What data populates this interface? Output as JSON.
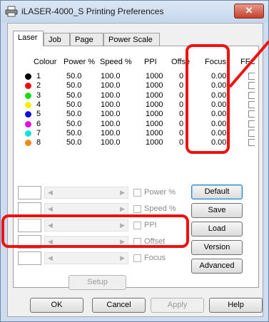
{
  "window": {
    "title": "iLASER-4000_S Printing Preferences",
    "close_label": "✕"
  },
  "tabs": [
    {
      "label": "Laser",
      "active": true
    },
    {
      "label": "Job",
      "active": false
    },
    {
      "label": "Page",
      "active": false
    },
    {
      "label": "Power Scale",
      "active": false
    }
  ],
  "table": {
    "headers": [
      "Colour",
      "Power %",
      "Speed %",
      "PPI",
      "Offse",
      "Focus",
      "FFO"
    ],
    "rows": [
      {
        "num": "1",
        "color": "#000000",
        "power": "50.0",
        "speed": "100.0",
        "ppi": "1000",
        "offset": "0",
        "focus": "0.00"
      },
      {
        "num": "2",
        "color": "#e81010",
        "power": "50.0",
        "speed": "100.0",
        "ppi": "1000",
        "offset": "0",
        "focus": "0.00"
      },
      {
        "num": "3",
        "color": "#18d818",
        "power": "50.0",
        "speed": "100.0",
        "ppi": "1000",
        "offset": "0",
        "focus": "0.00"
      },
      {
        "num": "4",
        "color": "#f5f000",
        "power": "50.0",
        "speed": "100.0",
        "ppi": "1000",
        "offset": "0",
        "focus": "0.00"
      },
      {
        "num": "5",
        "color": "#1010d8",
        "power": "50.0",
        "speed": "100.0",
        "ppi": "1000",
        "offset": "0",
        "focus": "0.00"
      },
      {
        "num": "6",
        "color": "#e010e0",
        "power": "50.0",
        "speed": "100.0",
        "ppi": "1000",
        "offset": "0",
        "focus": "0.00"
      },
      {
        "num": "7",
        "color": "#10e0e8",
        "power": "50.0",
        "speed": "100.0",
        "ppi": "1000",
        "offset": "0",
        "focus": "0.00"
      },
      {
        "num": "8",
        "color": "#f08a18",
        "power": "50.0",
        "speed": "100.0",
        "ppi": "1000",
        "offset": "0",
        "focus": "0.00"
      }
    ]
  },
  "controls": {
    "checkbox_labels": [
      "Power %",
      "Speed %",
      "PPI",
      "Offset",
      "Focus"
    ],
    "scroll_left": "◀",
    "scroll_right": "▶"
  },
  "buttons": {
    "default": "Default",
    "save": "Save",
    "load": "Load",
    "version": "Version",
    "advanced": "Advanced",
    "setup": "Setup",
    "ok": "OK",
    "cancel": "Cancel",
    "apply": "Apply",
    "help": "Help"
  },
  "colors": {
    "annotation_red": "#ee1111",
    "title_bar": "#c5d6ec"
  }
}
